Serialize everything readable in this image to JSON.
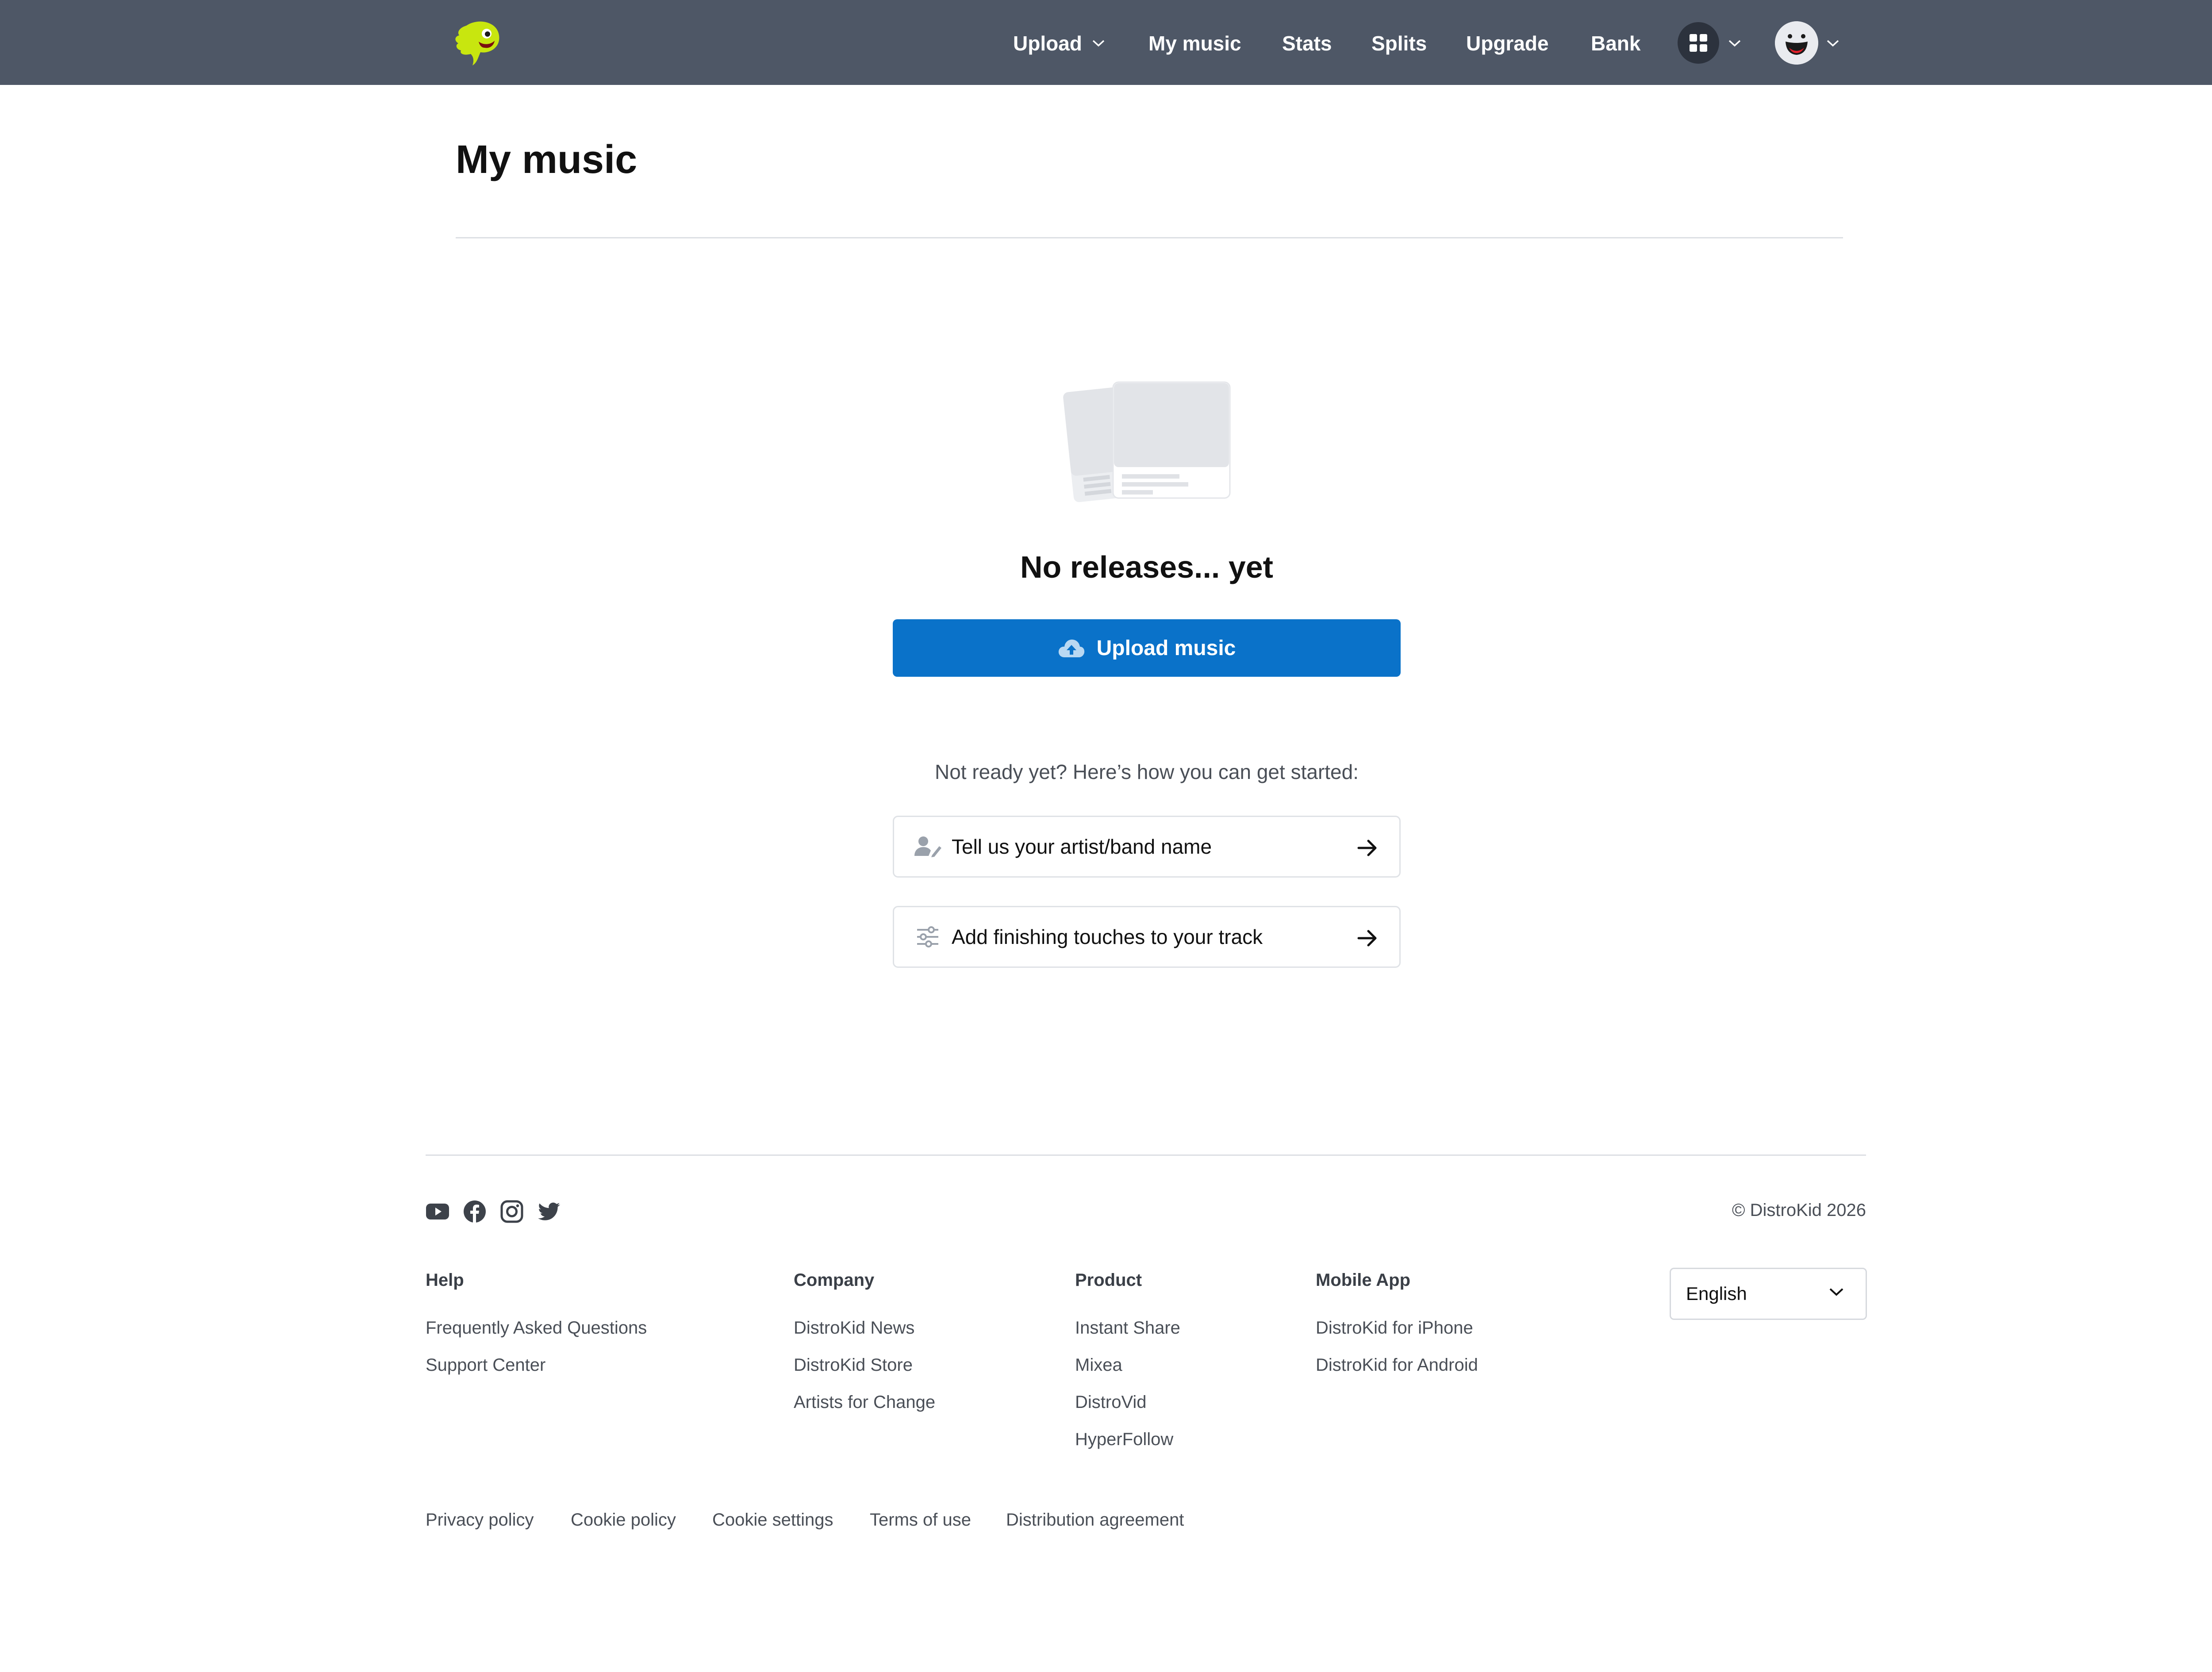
{
  "header": {
    "nav": [
      {
        "label": "Upload",
        "has_dropdown": true
      },
      {
        "label": "My music"
      },
      {
        "label": "Stats"
      },
      {
        "label": "Splits"
      },
      {
        "label": "Upgrade"
      },
      {
        "label": "Bank"
      }
    ],
    "icons": {
      "logo": "distrokid-logo-icon",
      "apps": "grid-icon",
      "avatar": "avatar-icon",
      "dropdown": "chevron-down-icon"
    }
  },
  "main": {
    "title": "My music",
    "empty_state": {
      "heading": "No releases... yet",
      "upload_button_label": "Upload music",
      "hint": "Not ready yet? Here’s how you can get started:",
      "tasks": [
        {
          "label": "Tell us your artist/band name",
          "icon": "user-edit-icon"
        },
        {
          "label": "Add finishing touches to your track",
          "icon": "sliders-icon"
        }
      ]
    }
  },
  "footer": {
    "social": [
      "youtube-icon",
      "facebook-icon",
      "instagram-icon",
      "twitter-icon"
    ],
    "copyright": "© DistroKid 2026",
    "columns": [
      {
        "heading": "Help",
        "links": [
          "Frequently Asked  Questions",
          "Support Center"
        ]
      },
      {
        "heading": "Company",
        "links": [
          "DistroKid News",
          "DistroKid Store",
          "Artists for Change"
        ]
      },
      {
        "heading": "Product",
        "links": [
          "Instant Share",
          "Mixea",
          "DistroVid",
          "HyperFollow"
        ]
      },
      {
        "heading": "Mobile App",
        "links": [
          "DistroKid for iPhone",
          "DistroKid for Android"
        ]
      }
    ],
    "language": "English",
    "legal": [
      "Privacy policy",
      "Cookie policy",
      "Cookie settings",
      "Terms of use",
      "Distribution agreement"
    ]
  },
  "colors": {
    "header_bg": "#4e5766",
    "accent_blue": "#0a72c9",
    "logo_green": "#c8e60f"
  }
}
